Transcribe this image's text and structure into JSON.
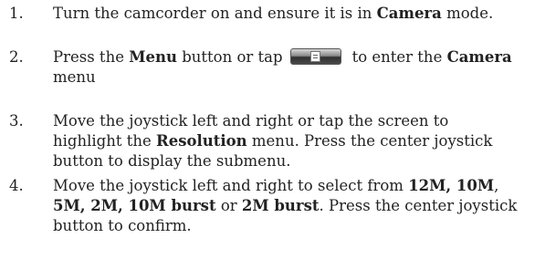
{
  "steps": [
    {
      "number": "1.",
      "line1": {
        "t1": "Turn the camcorder on and ensure it is in ",
        "b1": "Camera",
        "t2": " mode."
      }
    },
    {
      "number": "2.",
      "line1": {
        "t1": "Press the ",
        "b1": "Menu",
        "t2": " button or tap",
        "t3": "to enter the ",
        "b2": "Camera"
      },
      "line2": "menu",
      "icon": "menu-button-icon"
    },
    {
      "number": "3.",
      "line1": "Move the joystick left and right or tap the screen to",
      "line2": {
        "t1": "highlight the ",
        "b1": "Resolution",
        "t2": " menu. Press the center joystick"
      },
      "line3": "button to display the submenu."
    },
    {
      "number": "4.",
      "line1": {
        "t1": "Move the joystick left and right to select from ",
        "b1": "12M, 10M",
        "t2": ","
      },
      "line2": {
        "b1": "5M, 2M, 10M burst",
        "t1": " or ",
        "b2": "2M burst",
        "t2": ". Press the center joystick"
      },
      "line3": "button to confirm."
    }
  ]
}
